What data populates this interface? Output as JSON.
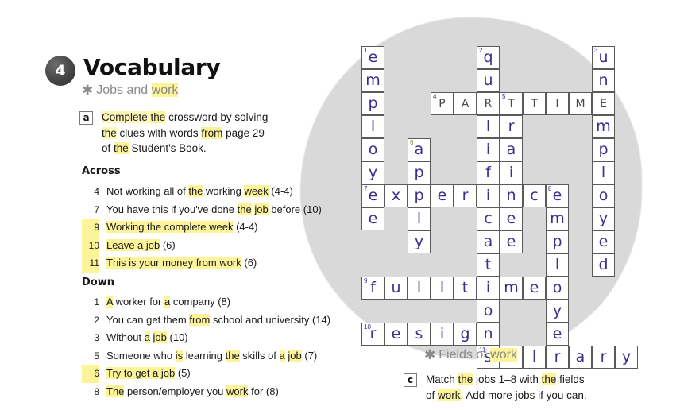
{
  "unit": {
    "number": "4",
    "title": "Vocabulary",
    "subtitle": "Jobs and work",
    "subtitle_highlight": "work"
  },
  "task_a": {
    "letter": "a",
    "line1_pre": "Complete ",
    "line1_hl": "the",
    "line1_post": " crossword by solving",
    "line2_a": "the",
    "line2_b": " clues with words ",
    "line2_c": "from",
    "line2_d": " page 29",
    "line3_a": "of ",
    "line3_b": "the",
    "line3_c": " Student's Book."
  },
  "across": {
    "heading": "Across",
    "clues": [
      {
        "num": "4",
        "text": "Not working all of the working week (4-4)"
      },
      {
        "num": "7",
        "text": "You have this if you've done the job before (10)"
      },
      {
        "num": "9",
        "text": "Working the complete week (4-4)"
      },
      {
        "num": "10",
        "text": "Leave a job (6)"
      },
      {
        "num": "11",
        "text": "This is your money from work (6)"
      }
    ]
  },
  "down": {
    "heading": "Down",
    "clues": [
      {
        "num": "1",
        "text": "A worker for a company (8)"
      },
      {
        "num": "2",
        "text": "You can get them from school and university (14)"
      },
      {
        "num": "3",
        "text": "Without a job (10)"
      },
      {
        "num": "5",
        "text": "Someone who is learning the skills of a job (7)"
      },
      {
        "num": "6",
        "text": "Try to get a job (5)"
      },
      {
        "num": "8",
        "text": "The person/employer you work for (8)"
      }
    ]
  },
  "fields": {
    "heading": "Fields of work",
    "heading_highlight": "work",
    "letter": "c",
    "line1_a": "Match ",
    "line1_b": "the",
    "line1_c": " jobs 1–8 with ",
    "line1_d": "the",
    "line1_e": " fields",
    "line2_a": "of ",
    "line2_b": "work",
    "line2_c": ". Add more jobs if you can."
  },
  "crossword": {
    "cell_size": 29,
    "answers": {
      "1_down": "employee",
      "2_down": "qualifications",
      "3_down": "unemployed",
      "5_down": "trainee",
      "6_down": "apply",
      "8_down": "employer",
      "4_across": "PARTTIME",
      "7_across": "experience",
      "9_across": "fulltime",
      "10_across": "resign",
      "11_across": "salary"
    },
    "cells": [
      {
        "r": 0,
        "c": 0,
        "ch": "e",
        "n": "1"
      },
      {
        "r": 1,
        "c": 0,
        "ch": "m"
      },
      {
        "r": 2,
        "c": 0,
        "ch": "p"
      },
      {
        "r": 3,
        "c": 0,
        "ch": "l"
      },
      {
        "r": 4,
        "c": 0,
        "ch": "o"
      },
      {
        "r": 5,
        "c": 0,
        "ch": "y"
      },
      {
        "r": 6,
        "c": 0,
        "ch": "e",
        "n": "7"
      },
      {
        "r": 7,
        "c": 0,
        "ch": "e"
      },
      {
        "r": 4,
        "c": 2,
        "ch": "a",
        "n": "6",
        "green": true
      },
      {
        "r": 5,
        "c": 2,
        "ch": "p"
      },
      {
        "r": 6,
        "c": 2,
        "ch": "p"
      },
      {
        "r": 7,
        "c": 2,
        "ch": "l"
      },
      {
        "r": 8,
        "c": 2,
        "ch": "y"
      },
      {
        "r": 6,
        "c": 1,
        "ch": "x"
      },
      {
        "r": 6,
        "c": 3,
        "ch": "e"
      },
      {
        "r": 6,
        "c": 4,
        "ch": "r"
      },
      {
        "r": 0,
        "c": 5,
        "ch": "q",
        "n": "2"
      },
      {
        "r": 1,
        "c": 5,
        "ch": "u"
      },
      {
        "r": 3,
        "c": 5,
        "ch": "l"
      },
      {
        "r": 4,
        "c": 5,
        "ch": "i"
      },
      {
        "r": 5,
        "c": 5,
        "ch": "f"
      },
      {
        "r": 6,
        "c": 5,
        "ch": "i"
      },
      {
        "r": 7,
        "c": 5,
        "ch": "c"
      },
      {
        "r": 8,
        "c": 5,
        "ch": "a"
      },
      {
        "r": 9,
        "c": 5,
        "ch": "t"
      },
      {
        "r": 10,
        "c": 5,
        "ch": "i"
      },
      {
        "r": 11,
        "c": 5,
        "ch": "o"
      },
      {
        "r": 12,
        "c": 5,
        "ch": "n"
      },
      {
        "r": 13,
        "c": 5,
        "ch": "s",
        "n": "11"
      },
      {
        "r": 2,
        "c": 3,
        "ch": "P",
        "n": "4",
        "given": true
      },
      {
        "r": 2,
        "c": 4,
        "ch": "A",
        "given": true
      },
      {
        "r": 2,
        "c": 5,
        "ch": "R",
        "given": true
      },
      {
        "r": 2,
        "c": 6,
        "ch": "T",
        "n": "5",
        "given": true
      },
      {
        "r": 2,
        "c": 7,
        "ch": "T",
        "given": true
      },
      {
        "r": 2,
        "c": 8,
        "ch": "I",
        "given": true
      },
      {
        "r": 2,
        "c": 9,
        "ch": "M",
        "given": true
      },
      {
        "r": 2,
        "c": 10,
        "ch": "E",
        "given": true
      },
      {
        "r": 3,
        "c": 6,
        "ch": "r"
      },
      {
        "r": 4,
        "c": 6,
        "ch": "a"
      },
      {
        "r": 5,
        "c": 6,
        "ch": "i"
      },
      {
        "r": 6,
        "c": 6,
        "ch": "n"
      },
      {
        "r": 7,
        "c": 6,
        "ch": "e"
      },
      {
        "r": 8,
        "c": 6,
        "ch": "e"
      },
      {
        "r": 6,
        "c": 7,
        "ch": "c"
      },
      {
        "r": 6,
        "c": 8,
        "ch": "e",
        "n": "8"
      },
      {
        "r": 7,
        "c": 8,
        "ch": "m"
      },
      {
        "r": 8,
        "c": 8,
        "ch": "p"
      },
      {
        "r": 9,
        "c": 8,
        "ch": "l"
      },
      {
        "r": 10,
        "c": 8,
        "ch": "o"
      },
      {
        "r": 11,
        "c": 8,
        "ch": "y"
      },
      {
        "r": 12,
        "c": 8,
        "ch": "e"
      },
      {
        "r": 13,
        "c": 8,
        "ch": "r"
      },
      {
        "r": 0,
        "c": 10,
        "ch": "u",
        "n": "3"
      },
      {
        "r": 1,
        "c": 10,
        "ch": "n"
      },
      {
        "r": 3,
        "c": 10,
        "ch": "m"
      },
      {
        "r": 4,
        "c": 10,
        "ch": "p"
      },
      {
        "r": 5,
        "c": 10,
        "ch": "l"
      },
      {
        "r": 6,
        "c": 10,
        "ch": "o"
      },
      {
        "r": 7,
        "c": 10,
        "ch": "y"
      },
      {
        "r": 8,
        "c": 10,
        "ch": "e"
      },
      {
        "r": 9,
        "c": 10,
        "ch": "d"
      },
      {
        "r": 10,
        "c": 0,
        "ch": "f",
        "n": "9"
      },
      {
        "r": 10,
        "c": 1,
        "ch": "u"
      },
      {
        "r": 10,
        "c": 2,
        "ch": "l"
      },
      {
        "r": 10,
        "c": 3,
        "ch": "l"
      },
      {
        "r": 10,
        "c": 4,
        "ch": "t"
      },
      {
        "r": 10,
        "c": 6,
        "ch": "m"
      },
      {
        "r": 10,
        "c": 7,
        "ch": "e"
      },
      {
        "r": 12,
        "c": 0,
        "ch": "r",
        "n": "10"
      },
      {
        "r": 12,
        "c": 1,
        "ch": "e"
      },
      {
        "r": 12,
        "c": 2,
        "ch": "s"
      },
      {
        "r": 12,
        "c": 3,
        "ch": "i"
      },
      {
        "r": 12,
        "c": 4,
        "ch": "g"
      },
      {
        "r": 13,
        "c": 6,
        "ch": "a"
      },
      {
        "r": 13,
        "c": 7,
        "ch": "l"
      },
      {
        "r": 13,
        "c": 9,
        "ch": "a"
      },
      {
        "r": 13,
        "c": 10,
        "ch": "r"
      },
      {
        "r": 13,
        "c": 11,
        "ch": "y"
      }
    ]
  }
}
